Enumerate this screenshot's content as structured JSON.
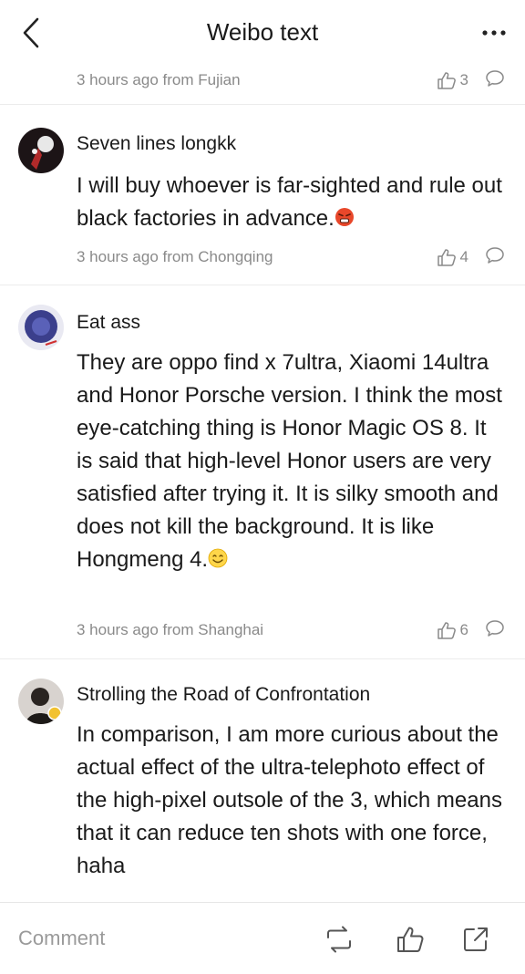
{
  "header": {
    "title": "Weibo text",
    "back_icon": "chevron-left-icon",
    "more_icon": "more-dots-icon"
  },
  "top_meta": {
    "time_location": "3 hours ago from Fujian",
    "likes": "3"
  },
  "comments": [
    {
      "username": "Seven lines longkk",
      "text": "I will buy whoever is far-sighted and rule out black factories in advance.",
      "emoji": "angry-emoji-icon",
      "time_location": "3 hours ago from Chongqing",
      "likes": "4"
    },
    {
      "username": "Eat ass",
      "text": "They are oppo find x 7ultra, Xiaomi 14ultra and Honor Porsche version. I think the most eye-catching thing is Honor Magic OS 8. It is said that high-level Honor users are very satisfied after trying it. It is silky smooth and does not kill the background. It is like Hongmeng 4.",
      "emoji": "smile-emoji-icon",
      "time_location": "3 hours ago from Shanghai",
      "likes": "6"
    },
    {
      "username": "Strolling the Road of Confrontation",
      "text": "In comparison, I am more curious about the actual effect of the ultra-telephoto effect of the high-pixel outsole of the 3, which means that it can reduce ten shots with one force, haha"
    }
  ],
  "bottom_bar": {
    "comment_placeholder": "Comment",
    "icons": [
      "repost-icon",
      "thumbs-up-icon",
      "share-icon"
    ]
  },
  "colors": {
    "text_primary": "#1a1a1a",
    "text_secondary": "#8a8a8a",
    "divider": "#ececec",
    "background": "#ffffff"
  }
}
